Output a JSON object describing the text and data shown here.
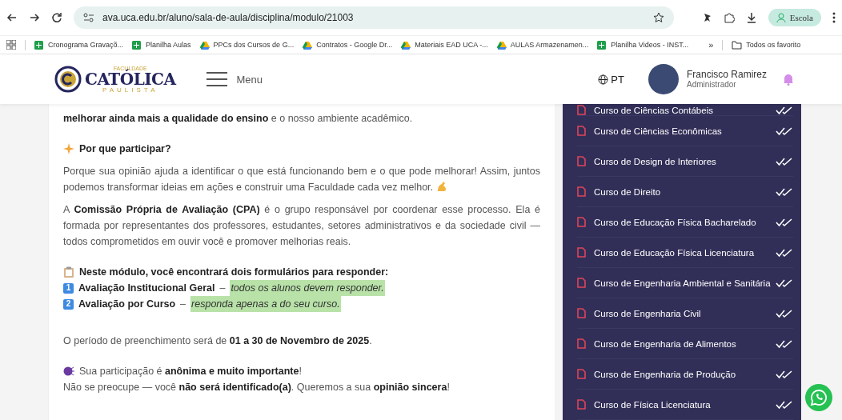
{
  "browser": {
    "url": "ava.uca.edu.br/aluno/sala-de-aula/disciplina/modulo/21003",
    "profile": "Escola",
    "bookmarks": [
      {
        "label": "Cronograma Gravaçõ...",
        "kind": "sheet"
      },
      {
        "label": "Planilha Aulas",
        "kind": "sheet"
      },
      {
        "label": "PPCs dos Cursos de G...",
        "kind": "drive"
      },
      {
        "label": "Contratos - Google Dr...",
        "kind": "drive"
      },
      {
        "label": "Materiais EAD UCA -...",
        "kind": "drive"
      },
      {
        "label": "AULAS Armazenamen...",
        "kind": "drive"
      },
      {
        "label": "Planilha Videos - INST...",
        "kind": "sheet"
      }
    ],
    "more": "»",
    "all_bookmarks": "Todos os favorito"
  },
  "header": {
    "logo": {
      "top": "FACULDADE",
      "main": "CATÓLICA",
      "bottom": "PAULISTA"
    },
    "menu": "Menu",
    "language": "PT",
    "user": {
      "name": "Francisco Ramirez",
      "role": "Administrador"
    }
  },
  "content": [
    {
      "kind": "para",
      "text": "**melhorar ainda mais a qualidade do ensino** e o nosso ambiente acadêmico."
    },
    {
      "kind": "gap"
    },
    {
      "kind": "heading",
      "text": "Por que participar?"
    },
    {
      "kind": "cheer",
      "text": "Porque sua opinião ajuda a identificar o que está funcionando bem e o que pode melhorar! Assim, juntos podemos transformar ideias em ações e construir uma Faculdade cada vez melhor."
    },
    {
      "kind": "para",
      "text": "A **Comissão Própria de Avaliação (CPA)** é o grupo responsável por coordenar esse processo. Ela é formada por representantes dos professores, estudantes, setores administrativos e da sociedade civil — todos comprometidos em ouvir você e promover melhorias reais."
    },
    {
      "kind": "gap"
    },
    {
      "kind": "heading",
      "text": "Neste módulo, você encontrará dois formulários para responder:"
    },
    {
      "kind": "item",
      "number": "1",
      "title": "Avaliação Institucional Geral",
      "dash": "–",
      "note": "todos os alunos devem responder."
    },
    {
      "kind": "item",
      "number": "2",
      "title": "Avaliação por Curso",
      "dash": "–",
      "note": "responda apenas a do seu curso."
    },
    {
      "kind": "gap"
    },
    {
      "kind": "para",
      "text": "O período de preenchimento será de **01 a 30 de Novembro de 2025**."
    },
    {
      "kind": "gap"
    },
    {
      "kind": "note",
      "text": "Sua participação é **anônima e muito importante**!"
    },
    {
      "kind": "cont",
      "text": "Não se preocupe — você **não será identificado(a)**. Queremos a sua **opinião sincera**!"
    }
  ],
  "courses": [
    {
      "name": "Curso de Ciências Contábeis",
      "completed": true
    },
    {
      "name": "Curso de Ciências Econômicas",
      "completed": true
    },
    {
      "name": "Curso de Design de Interiores",
      "completed": true
    },
    {
      "name": "Curso de Direito",
      "completed": true
    },
    {
      "name": "Curso de Educação Física Bacharelado",
      "completed": true
    },
    {
      "name": "Curso de Educação Física Licenciatura",
      "completed": true
    },
    {
      "name": "Curso de Engenharia Ambiental e Sanitária",
      "completed": true
    },
    {
      "name": "Curso de Engenharia Civil",
      "completed": true
    },
    {
      "name": "Curso de Engenharia de Alimentos",
      "completed": true
    },
    {
      "name": "Curso de Engenharia de Produção",
      "completed": true
    },
    {
      "name": "Curso de Física Licenciatura",
      "completed": true
    }
  ]
}
